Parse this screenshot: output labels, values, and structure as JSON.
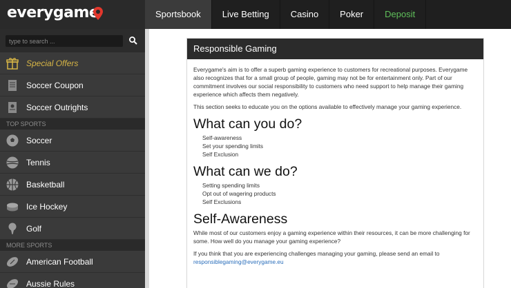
{
  "brand": {
    "logo_text": "everygame"
  },
  "nav": {
    "items": [
      {
        "label": "Sportsbook",
        "active": true
      },
      {
        "label": "Live Betting"
      },
      {
        "label": "Casino"
      },
      {
        "label": "Poker"
      },
      {
        "label": "Deposit",
        "accent": "#5fbf5a"
      }
    ]
  },
  "sidebar": {
    "search_placeholder": "type to search ...",
    "items_top": [
      {
        "label": "Special Offers",
        "icon": "gift-icon"
      },
      {
        "label": "Soccer Coupon",
        "icon": "coupon-icon"
      },
      {
        "label": "Soccer Outrights",
        "icon": "outrights-icon"
      }
    ],
    "top_sports_heading": "TOP SPORTS",
    "top_sports": [
      {
        "label": "Soccer",
        "icon": "soccer-ball-icon"
      },
      {
        "label": "Tennis",
        "icon": "tennis-ball-icon"
      },
      {
        "label": "Basketball",
        "icon": "basketball-icon"
      },
      {
        "label": "Ice Hockey",
        "icon": "hockey-puck-icon"
      },
      {
        "label": "Golf",
        "icon": "golf-ball-icon"
      }
    ],
    "more_sports_heading": "MORE SPORTS",
    "more_sports": [
      {
        "label": "American Football",
        "icon": "american-football-icon"
      },
      {
        "label": "Aussie Rules",
        "icon": "aussie-rules-icon"
      }
    ]
  },
  "content": {
    "panel_title": "Responsible Gaming",
    "intro": "Everygame's aim is to offer a superb gaming experience to customers for recreational purposes. Everygame also recognizes that for a small group of people, gaming may not be for entertainment only. Part of our commitment involves our social responsibility to customers who need support to help manage their gaming experience which affects them negatively.",
    "educate": "This section seeks to educate you on the options available to effectively manage your gaming experience.",
    "what_you_heading": "What can you do?",
    "what_you_items": [
      "Self-awareness",
      "Set your spending limits",
      "Self Exclusion"
    ],
    "what_we_heading": "What can we do?",
    "what_we_items": [
      "Setting spending limits",
      "Opt out of wagering products",
      "Self Exclusions"
    ],
    "self_awareness_heading": "Self-Awareness",
    "self_awareness_p1": "While most of our customers enjoy a gaming experience within their resources, it can be more challenging for some. How well do you manage your gaming experience?",
    "self_awareness_p2": "If you think that you are experiencing challenges managing your gaming, please send an email to",
    "email": "responsiblegaming@everygame.eu"
  },
  "colors": {
    "topbar": "#1f1f1f",
    "sidebar": "#3a3a3a",
    "special_offers": "#d8b646",
    "deposit": "#5fbf5a",
    "logo_pin": "#e2372c",
    "link": "#2a6ebb"
  }
}
